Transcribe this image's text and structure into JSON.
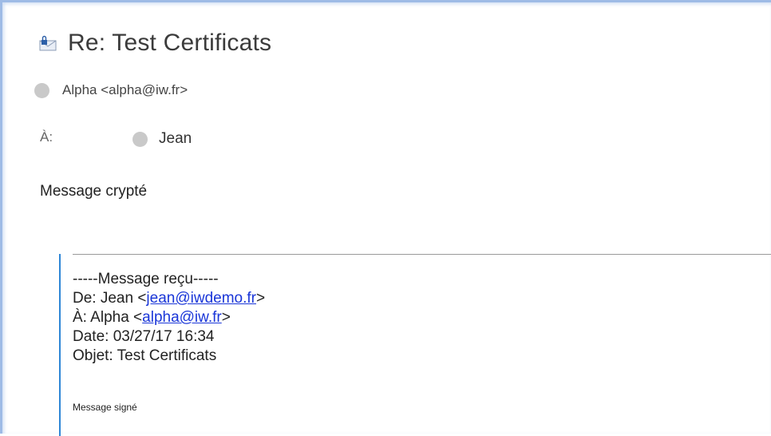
{
  "message": {
    "subject": "Re: Test Certificats",
    "sender": "Alpha <alpha@iw.fr>",
    "to_label": "À:",
    "recipient": "Jean",
    "body": "Message crypté"
  },
  "quoted": {
    "separator": "-----Message reçu-----",
    "from_prefix": "De: Jean <",
    "from_email": "jean@iwdemo.fr",
    "from_suffix": ">",
    "to_prefix": "À: Alpha <",
    "to_email": "alpha@iw.fr",
    "to_suffix": ">",
    "date": "Date: 03/27/17 16:34",
    "subject": "Objet: Test Certificats",
    "footer": "Message signé"
  },
  "icons": {
    "subject_icon": "lock-envelope-icon",
    "avatar_icon": "avatar"
  },
  "colors": {
    "frame": "#9ebbe6",
    "quote_bar": "#2e86d6",
    "link": "#1a36d8",
    "avatar": "#c9c9c9"
  }
}
